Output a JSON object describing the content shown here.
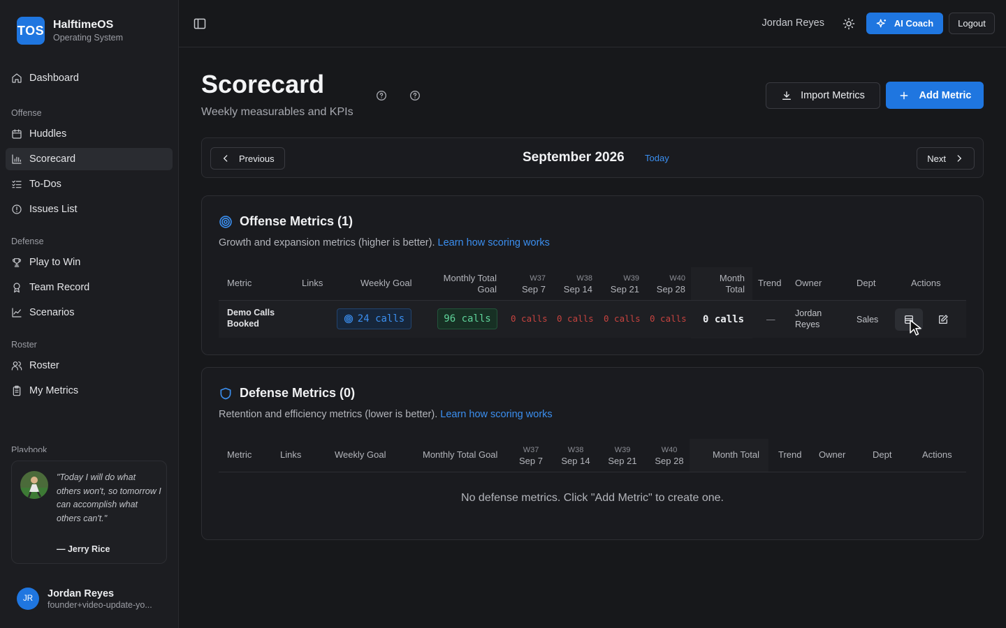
{
  "brand": {
    "logo": "TOS",
    "name": "HalftimeOS",
    "subtitle": "Operating System"
  },
  "sidebar": {
    "dashboard": "Dashboard",
    "sections": [
      {
        "title": "Offense",
        "items": [
          "Huddles",
          "Scorecard",
          "To-Dos",
          "Issues List"
        ]
      },
      {
        "title": "Defense",
        "items": [
          "Play to Win",
          "Team Record",
          "Scenarios"
        ]
      },
      {
        "title": "Roster",
        "items": [
          "Roster",
          "My Metrics"
        ]
      }
    ],
    "cut_section": "Playbook",
    "active_item": "Scorecard",
    "quote": {
      "text": "\"Today I will do what others won't, so tomorrow I can accomplish what others can't.\"",
      "author": "— Jerry Rice"
    },
    "user": {
      "initials": "JR",
      "name": "Jordan Reyes",
      "email": "founder+video-update-yo..."
    }
  },
  "topbar": {
    "user_name": "Jordan Reyes",
    "ai_coach": "AI Coach",
    "logout": "Logout"
  },
  "page": {
    "title": "Scorecard",
    "subtitle": "Weekly measurables and KPIs",
    "import_label": "Import Metrics",
    "add_label": "Add Metric"
  },
  "month_nav": {
    "previous": "Previous",
    "month": "September 2026",
    "today": "Today",
    "next": "Next"
  },
  "offense": {
    "title": "Offense Metrics (1)",
    "description": "Growth and expansion metrics (higher is better).",
    "learn_link": "Learn how scoring works",
    "headers": {
      "metric": "Metric",
      "links": "Links",
      "weekly_goal": "Weekly Goal",
      "monthly_l1": "Monthly Total",
      "monthly_l2": "Goal",
      "w37": "W37",
      "w37d": "Sep 7",
      "w38": "W38",
      "w38d": "Sep 14",
      "w39": "W39",
      "w39d": "Sep 21",
      "w40": "W40",
      "w40d": "Sep 28",
      "month_l1": "Month",
      "month_l2": "Total",
      "trend": "Trend",
      "owner": "Owner",
      "dept": "Dept",
      "actions": "Actions"
    },
    "rows": [
      {
        "metric_l1": "Demo Calls",
        "metric_l2": "Booked",
        "weekly_goal": "24 calls",
        "monthly_goal": "96 calls",
        "weeks": [
          "0 calls",
          "0 calls",
          "0 calls",
          "0 calls"
        ],
        "month_total": "0 calls",
        "trend": "—",
        "owner_l1": "Jordan",
        "owner_l2": "Reyes",
        "dept": "Sales"
      }
    ]
  },
  "defense": {
    "title": "Defense Metrics (0)",
    "description": "Retention and efficiency metrics (lower is better).",
    "learn_link": "Learn how scoring works",
    "headers": {
      "metric": "Metric",
      "links": "Links",
      "weekly_goal": "Weekly Goal",
      "monthly": "Monthly Total Goal",
      "w37": "W37",
      "w37d": "Sep 7",
      "w38": "W38",
      "w38d": "Sep 14",
      "w39": "W39",
      "w39d": "Sep 21",
      "w40": "W40",
      "w40d": "Sep 28",
      "month": "Month Total",
      "trend": "Trend",
      "owner": "Owner",
      "dept": "Dept",
      "actions": "Actions"
    },
    "empty": "No defense metrics. Click \"Add Metric\" to create one."
  },
  "colors": {
    "accent": "#1f76e0",
    "link": "#3b8ff0",
    "negative": "#c7433f",
    "positive": "#5fd39a"
  }
}
